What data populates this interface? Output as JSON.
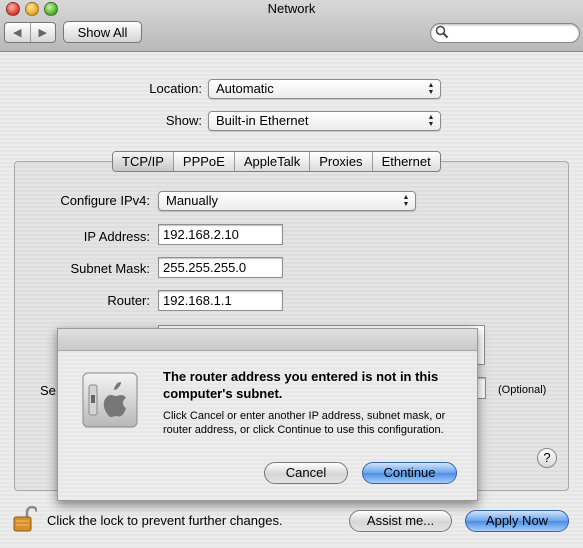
{
  "window": {
    "title": "Network",
    "show_all": "Show All",
    "search_placeholder": ""
  },
  "location": {
    "label": "Location:",
    "value": "Automatic"
  },
  "show": {
    "label": "Show:",
    "value": "Built-in Ethernet"
  },
  "tabs": [
    "TCP/IP",
    "PPPoE",
    "AppleTalk",
    "Proxies",
    "Ethernet"
  ],
  "selected_tab": "TCP/IP",
  "tcpip": {
    "configure_label": "Configure IPv4:",
    "configure_value": "Manually",
    "ip_label": "IP Address:",
    "ip_value": "192.168.2.10",
    "subnet_label": "Subnet Mask:",
    "subnet_value": "255.255.255.0",
    "router_label": "Router:",
    "router_value": "192.168.1.1",
    "partial_label": "Se",
    "optional": "(Optional)",
    "help": "?"
  },
  "alert": {
    "title": "The router address you entered is not in this computer's subnet.",
    "message": "Click Cancel or enter another IP address, subnet mask, or router address, or click Continue to use this configuration.",
    "cancel": "Cancel",
    "continue": "Continue"
  },
  "footer": {
    "lock_text": "Click the lock to prevent further changes.",
    "assist": "Assist me...",
    "apply": "Apply Now"
  },
  "colors": {
    "default_button": "#4b8ee6",
    "close": "#d9362b",
    "minimize": "#e7a21b",
    "zoom": "#4ea628"
  },
  "icons": [
    "back-arrow-icon",
    "forward-arrow-icon",
    "search-icon",
    "apple-network-icon",
    "lock-icon",
    "help-icon"
  ]
}
